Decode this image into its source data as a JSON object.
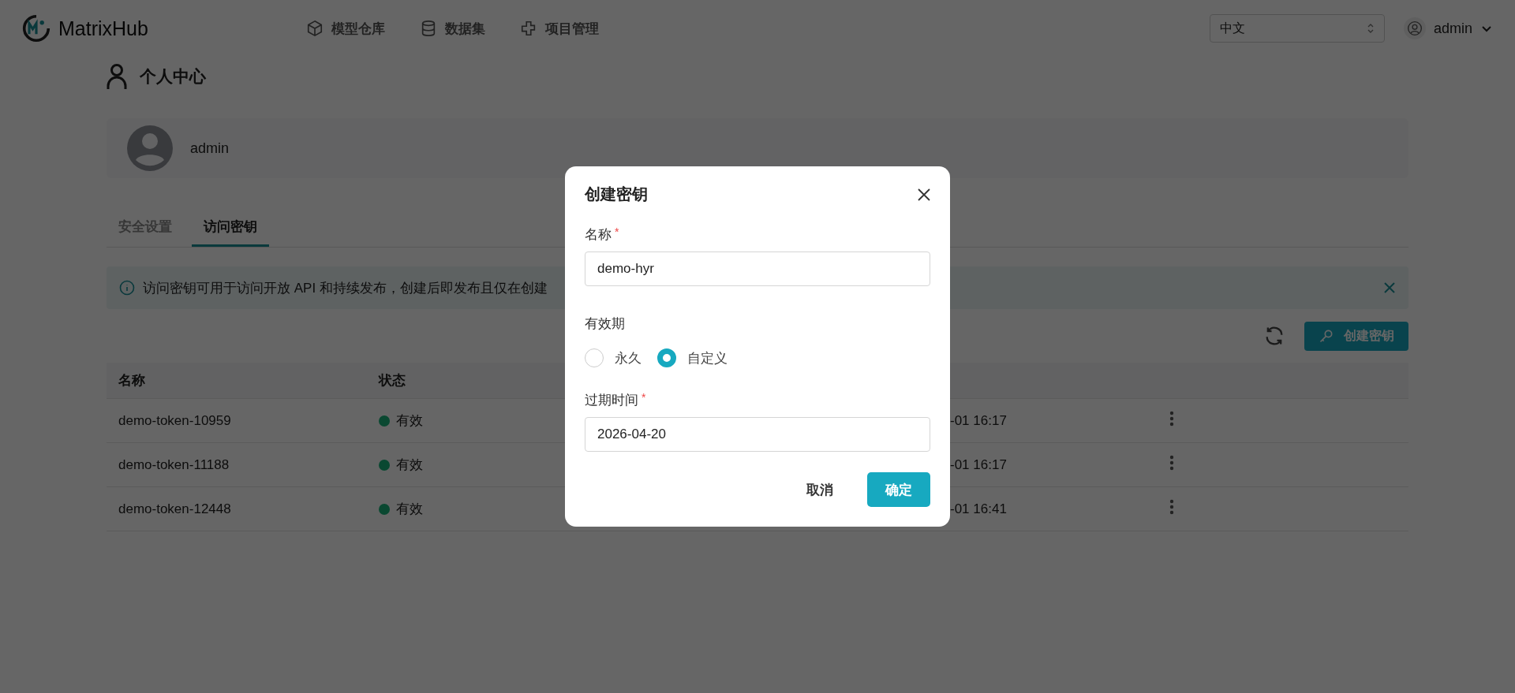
{
  "header": {
    "brand": "MatrixHub",
    "nav": [
      {
        "label": "模型仓库"
      },
      {
        "label": "数据集"
      },
      {
        "label": "项目管理"
      }
    ],
    "language": "中文",
    "user": "admin"
  },
  "page": {
    "title": "个人中心",
    "profile": {
      "name": "admin"
    },
    "tabs": [
      {
        "label": "安全设置",
        "selected": false
      },
      {
        "label": "访问密钥",
        "selected": true
      }
    ],
    "alert": {
      "text": "访问密钥可用于访问开放 API 和持续发布，创建后即发布且仅在创建"
    },
    "create_button": "创建密钥",
    "table": {
      "columns": [
        "名称",
        "状态"
      ],
      "rows": [
        {
          "name": "demo-token-10959",
          "status": "有效",
          "column_3": "-01 16:17"
        },
        {
          "name": "demo-token-11188",
          "status": "有效",
          "column_3": "-01 16:17"
        },
        {
          "name": "demo-token-12448",
          "status": "有效",
          "column_3": "-01 16:41"
        }
      ]
    }
  },
  "dialog": {
    "title": "创建密钥",
    "name_field": {
      "label": "名称",
      "required_mark": "*",
      "value": "demo-hyr"
    },
    "validity": {
      "label": "有效期",
      "options": [
        {
          "label": "永久",
          "selected": false
        },
        {
          "label": "自定义",
          "selected": true
        }
      ]
    },
    "expiry_field": {
      "label": "过期时间",
      "required_mark": "*",
      "value": "2026-04-20"
    },
    "buttons": [
      {
        "label": "取消",
        "kind": "secondary"
      },
      {
        "label": "确定",
        "kind": "primary"
      }
    ]
  }
}
